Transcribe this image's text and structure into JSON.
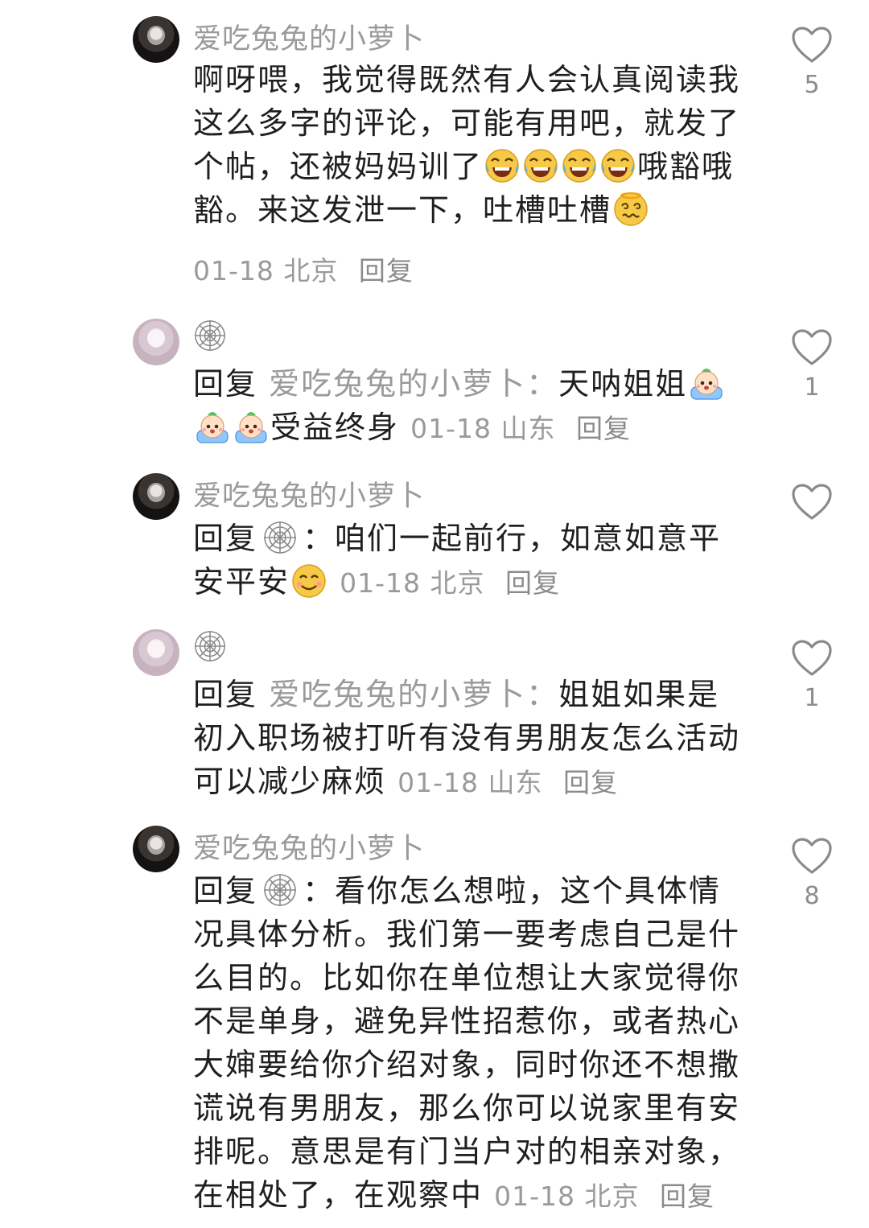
{
  "comments": [
    {
      "user": "爱吃兔兔的小萝卜",
      "text": {
        "p1": "啊呀喂，我觉得既然有人会认真阅读我这么多字的评论，可能有用吧，就发了个帖，还被妈妈训了",
        "p2": "哦豁哦豁。来这发泄一下，吐槽吐槽"
      },
      "date": "01-18",
      "location": "北京",
      "reply_label": "回复",
      "likes": "5"
    },
    {
      "reply_prefix": "回复",
      "reply_to": "爱吃兔兔的小萝卜：",
      "text": {
        "p1": "天呐姐姐",
        "p2": "受益终身"
      },
      "date": "01-18",
      "location": "山东",
      "reply_label": "回复",
      "likes": "1"
    },
    {
      "user": "爱吃兔兔的小萝卜",
      "reply_prefix": "回复",
      "reply_sep": "：",
      "text": {
        "p1": "咱们一起前行，如意如意平安平安"
      },
      "date": "01-18",
      "location": "北京",
      "reply_label": "回复",
      "likes": ""
    },
    {
      "reply_prefix": "回复",
      "reply_to": "爱吃兔兔的小萝卜：",
      "text": {
        "p1": "姐姐如果是初入职场被打听有没有男朋友怎么活动可以减少麻烦"
      },
      "date": "01-18",
      "location": "山东",
      "reply_label": "回复",
      "likes": "1"
    },
    {
      "user": "爱吃兔兔的小萝卜",
      "reply_prefix": "回复",
      "reply_sep": "：",
      "text": {
        "p1": "看你怎么想啦，这个具体情况具体分析。我们第一要考虑自己是什么目的。比如你在单位想让大家觉得你不是单身，避免异性招惹你，或者热心大婶要给你介绍对象，同时你还不想撒谎说有男朋友，那么你可以说家里有安排呢。意思是有门当户对的相亲对象，在相处了，在观察中"
      },
      "date": "01-18",
      "location": "北京",
      "reply_label": "回复",
      "likes": "8"
    }
  ]
}
